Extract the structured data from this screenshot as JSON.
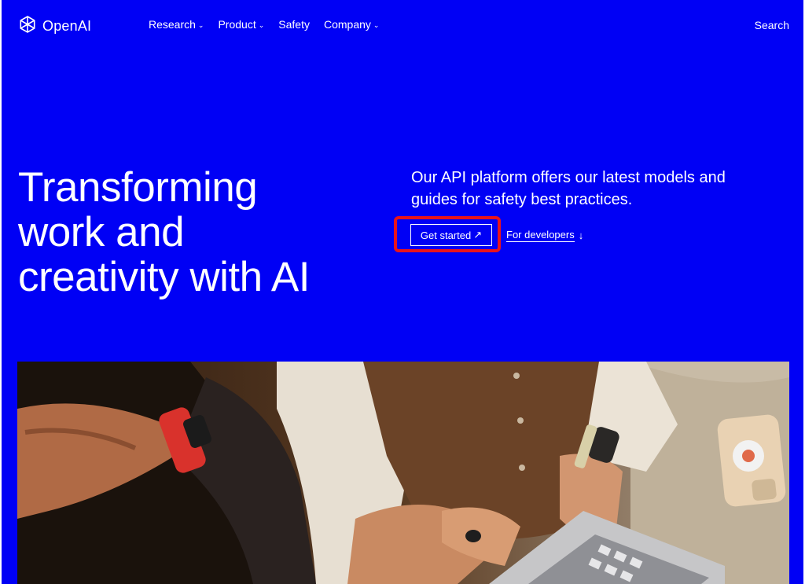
{
  "header": {
    "logo_text": "OpenAI",
    "nav": [
      {
        "label": "Research",
        "has_dropdown": true
      },
      {
        "label": "Product",
        "has_dropdown": true
      },
      {
        "label": "Safety",
        "has_dropdown": false
      },
      {
        "label": "Company",
        "has_dropdown": true
      }
    ],
    "search_label": "Search"
  },
  "hero": {
    "headline_lines": [
      "Transforming",
      "work and",
      "creativity with AI"
    ],
    "subtext": "Our API platform offers our latest models and guides for safety best practices.",
    "cta_label": "Get started",
    "cta_icon": "arrow-up-right-icon",
    "secondary_label": "For developers",
    "secondary_icon": "arrow-down-icon"
  },
  "colors": {
    "background": "#0000f5",
    "text": "#ffffff",
    "highlight": "#e8141b"
  },
  "image": {
    "alt_subject": "people-working-on-laptop-photo"
  }
}
